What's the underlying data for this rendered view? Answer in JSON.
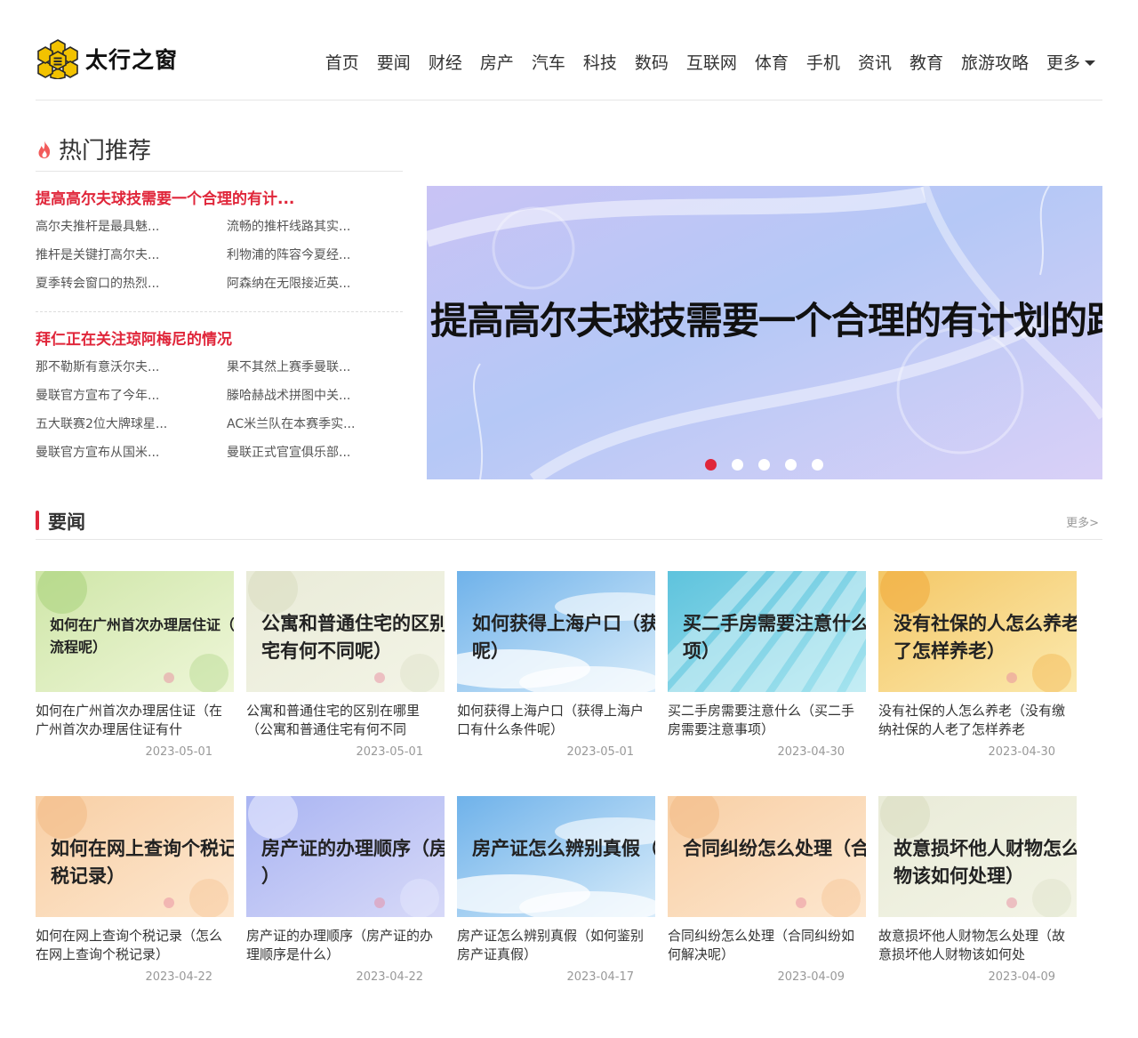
{
  "site": {
    "name": "太行之窗"
  },
  "nav": [
    "首页",
    "要闻",
    "财经",
    "房产",
    "汽车",
    "科技",
    "数码",
    "互联网",
    "体育",
    "手机",
    "资讯",
    "教育",
    "旅游攻略"
  ],
  "nav_more": "更多",
  "hot": {
    "title": "热门推荐",
    "groups": [
      {
        "lead": "提高高尔夫球技需要一个合理的有计...",
        "links": [
          "高尔夫推杆是最具魅...",
          "流畅的推杆线路其实...",
          "推杆是关键打高尔夫...",
          "利物浦的阵容今夏经...",
          "夏季转会窗口的热烈...",
          "阿森纳在无限接近英..."
        ]
      },
      {
        "lead": "拜仁正在关注琼阿梅尼的情况",
        "links": [
          "那不勒斯有意沃尔夫...",
          "果不其然上赛季曼联...",
          "曼联官方宣布了今年...",
          "滕哈赫战术拼图中关...",
          "五大联赛2位大牌球星...",
          "AC米兰队在本赛季实...",
          "曼联官方宣布从国米...",
          "曼联正式官宣俱乐部..."
        ]
      }
    ]
  },
  "banner": {
    "caption": "提高高尔夫球技需要一个合理的有计划的路径",
    "active_slide": 1,
    "slide_count": 5
  },
  "news": {
    "title": "要闻",
    "more": "更多>",
    "rows": [
      [
        {
          "thumb": "如何在广州首次办理居住证（在广州首次办理居住证有什么流程呢）",
          "thumb_line1": "如何在广州首次办理居住证（",
          "thumb_line2": "流程呢）",
          "title": "如何在广州首次办理居住证（在广州首次办理居住证有什",
          "date": "2023-05-01",
          "theme": "green"
        },
        {
          "thumb_line1": "公寓和普通住宅的区别",
          "thumb_line2": "宅有何不同呢）",
          "title": "公寓和普通住宅的区别在哪里（公寓和普通住宅有何不同",
          "date": "2023-05-01",
          "theme": "beige"
        },
        {
          "thumb_line1": "如何获得上海户口（获",
          "thumb_line2": "呢）",
          "title": "如何获得上海户口（获得上海户口有什么条件呢）",
          "date": "2023-05-01",
          "theme": "sky"
        },
        {
          "thumb_line1": "买二手房需要注意什么",
          "thumb_line2": "项）",
          "title": "买二手房需要注意什么（买二手房需要注意事项）",
          "date": "2023-04-30",
          "theme": "cyan"
        },
        {
          "thumb_line1": "没有社保的人怎么养老",
          "thumb_line2": "了怎样养老）",
          "title": "没有社保的人怎么养老（没有缴纳社保的人老了怎样养老",
          "date": "2023-04-30",
          "theme": "yellow"
        }
      ],
      [
        {
          "thumb_line1": "如何在网上查询个税记",
          "thumb_line2": "税记录）",
          "title": "如何在网上查询个税记录（怎么在网上查询个税记录）",
          "date": "2023-04-22",
          "theme": "peach"
        },
        {
          "thumb_line1": "房产证的办理顺序（房",
          "thumb_line2": "）",
          "title": "房产证的办理顺序（房产证的办理顺序是什么）",
          "date": "2023-04-22",
          "theme": "lilac"
        },
        {
          "thumb_line1": "房产证怎么辨别真假（如",
          "thumb_line2": "",
          "title": "房产证怎么辨别真假（如何鉴别房产证真假）",
          "date": "2023-04-17",
          "theme": "sky"
        },
        {
          "thumb_line1": "合同纠纷怎么处理（合",
          "thumb_line2": "",
          "title": "合同纠纷怎么处理（合同纠纷如何解决呢）",
          "date": "2023-04-09",
          "theme": "peach"
        },
        {
          "thumb_line1": "故意损坏他人财物怎么",
          "thumb_line2": "物该如何处理）",
          "title": "故意损坏他人财物怎么处理（故意损坏他人财物该如何处",
          "date": "2023-04-09",
          "theme": "beige"
        }
      ]
    ]
  },
  "colors": {
    "accent": "#e0263a",
    "logo": "#f2c200"
  }
}
